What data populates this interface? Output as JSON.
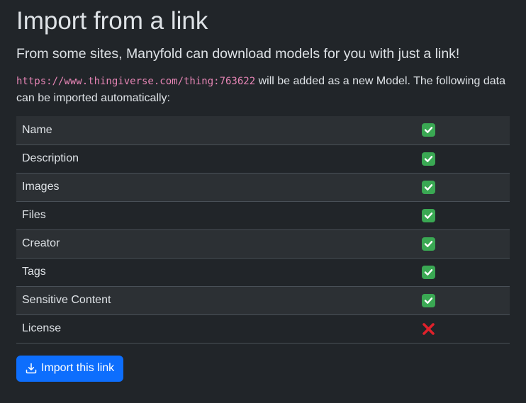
{
  "page": {
    "title": "Import from a link",
    "lead": "From some sites, Manyfold can download models for you with just a link!",
    "url": "https://www.thingiverse.com/thing:763622",
    "intro_suffix": " will be added as a new Model. The following data can be imported automatically:"
  },
  "fields": [
    {
      "label": "Name",
      "importable": true
    },
    {
      "label": "Description",
      "importable": true
    },
    {
      "label": "Images",
      "importable": true
    },
    {
      "label": "Files",
      "importable": true
    },
    {
      "label": "Creator",
      "importable": true
    },
    {
      "label": "Tags",
      "importable": true
    },
    {
      "label": "Sensitive Content",
      "importable": true
    },
    {
      "label": "License",
      "importable": false
    }
  ],
  "actions": {
    "import_label": "Import this link",
    "import_icon": "download-icon"
  },
  "colors": {
    "check": "#3aa853",
    "cross": "#e0212b",
    "button": "#0d6efd"
  }
}
